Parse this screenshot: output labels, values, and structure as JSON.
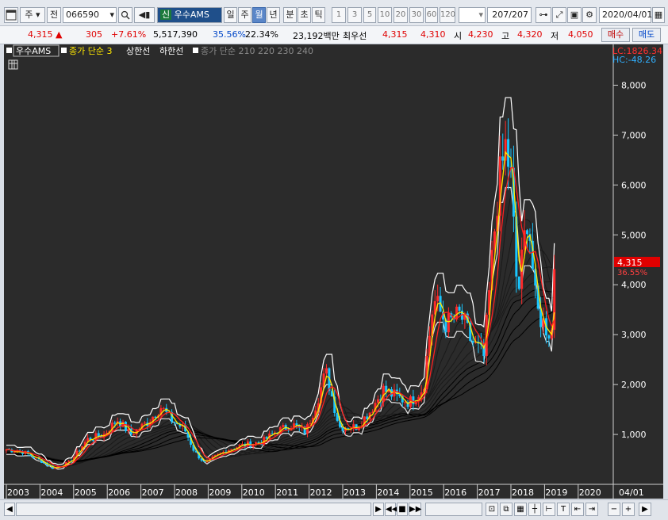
{
  "toolbar": {
    "market": "주",
    "prefix": "전",
    "code": "066590",
    "badge": "신",
    "name": "우수AMS",
    "periods": [
      "일",
      "주",
      "월",
      "년",
      "분",
      "초",
      "틱"
    ],
    "active_period": "월",
    "multipliers": [
      "1",
      "3",
      "5",
      "10",
      "20",
      "30",
      "60",
      "120"
    ],
    "count": "207/207",
    "date": "2020/04/01"
  },
  "quote": {
    "price": "4,315",
    "change": "305",
    "rate": "+7.61%",
    "volume": "5,517,390",
    "vol_ratio": "35.56%",
    "turnover": "22.34%",
    "amount": "23,192백만",
    "best_label": "최우선",
    "ask": "4,315",
    "bid": "4,310",
    "open_label": "시",
    "open": "4,230",
    "high_label": "고",
    "high": "4,320",
    "low_label": "저",
    "low": "4,050",
    "buy": "매수",
    "sell": "매도"
  },
  "legend": {
    "name": "우수AMS",
    "close_ma": "종가 단순 3",
    "upper": "상한선",
    "lower": "하한선",
    "ma_group": "종가 단순 210  220  230  240"
  },
  "indicators": {
    "lc": "LC:1826.34",
    "hc": "HC:-48.26",
    "last_price": "4,315",
    "last_rate": "36.55%"
  },
  "chart_data": {
    "type": "candlestick",
    "xlabels": [
      "2003",
      "2004",
      "2005",
      "2006",
      "2007",
      "2008",
      "2009",
      "2010",
      "2011",
      "2012",
      "2013",
      "2014",
      "2015",
      "2016",
      "2017",
      "2018",
      "2019",
      "2020"
    ],
    "yticks": [
      1000,
      2000,
      3000,
      4000,
      5000,
      6000,
      7000,
      8000
    ],
    "ylim": [
      0,
      8500
    ],
    "end_label": "04/01",
    "anchors": [
      [
        2003.0,
        700
      ],
      [
        2003.5,
        650
      ],
      [
        2004.0,
        480
      ],
      [
        2004.4,
        320
      ],
      [
        2004.9,
        450
      ],
      [
        2005.4,
        900
      ],
      [
        2005.9,
        1000
      ],
      [
        2006.3,
        1300
      ],
      [
        2006.7,
        1000
      ],
      [
        2007.2,
        1250
      ],
      [
        2007.6,
        1550
      ],
      [
        2007.9,
        1300
      ],
      [
        2008.3,
        1100
      ],
      [
        2008.6,
        650
      ],
      [
        2008.9,
        420
      ],
      [
        2009.2,
        550
      ],
      [
        2009.6,
        700
      ],
      [
        2010.0,
        780
      ],
      [
        2010.6,
        850
      ],
      [
        2011.0,
        1050
      ],
      [
        2011.5,
        1200
      ],
      [
        2011.9,
        1050
      ],
      [
        2012.2,
        1600
      ],
      [
        2012.5,
        2250
      ],
      [
        2012.7,
        1700
      ],
      [
        2012.9,
        1150
      ],
      [
        2013.4,
        1150
      ],
      [
        2013.8,
        1450
      ],
      [
        2014.2,
        1900
      ],
      [
        2014.6,
        1750
      ],
      [
        2015.0,
        1650
      ],
      [
        2015.4,
        1950
      ],
      [
        2015.7,
        3700
      ],
      [
        2016.1,
        3200
      ],
      [
        2016.5,
        3400
      ],
      [
        2016.8,
        2900
      ],
      [
        2017.2,
        2550
      ],
      [
        2017.6,
        5800
      ],
      [
        2017.85,
        6800
      ],
      [
        2018.0,
        6100
      ],
      [
        2018.2,
        3700
      ],
      [
        2018.5,
        5500
      ],
      [
        2018.75,
        3500
      ],
      [
        2019.0,
        3200
      ],
      [
        2019.2,
        3000
      ],
      [
        2019.35,
        4315
      ]
    ]
  }
}
